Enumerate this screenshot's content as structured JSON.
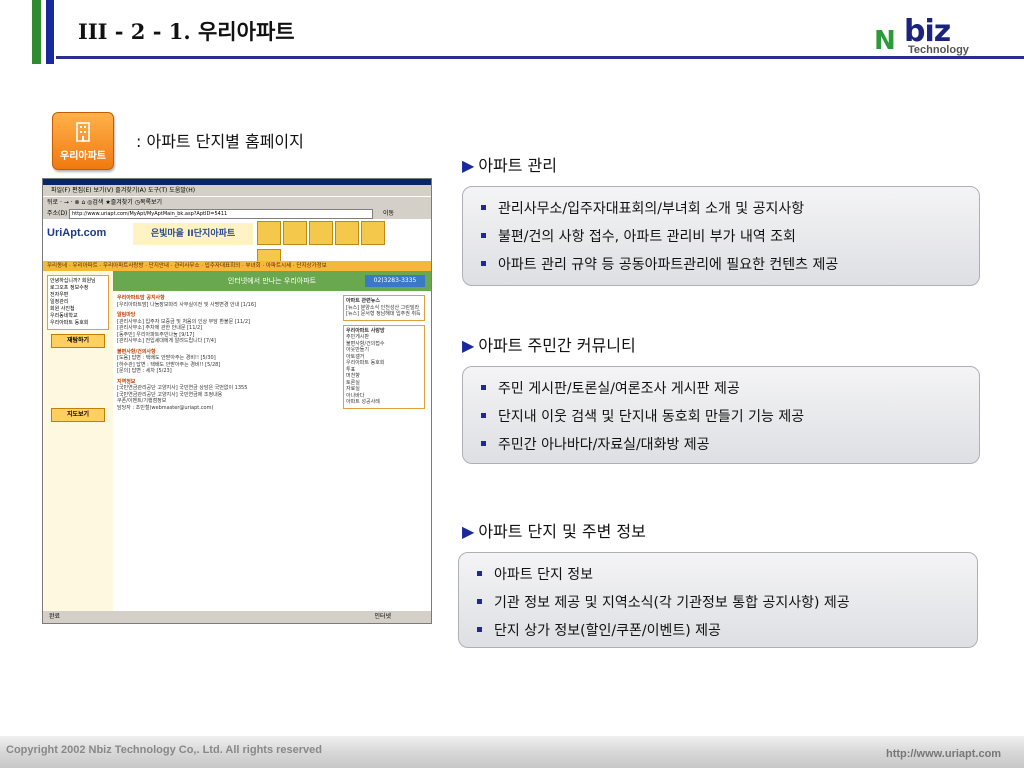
{
  "header": {
    "title": "III - 2 - 1. 우리아파트",
    "logo": {
      "n": "N",
      "biz": "biz",
      "technology": "Technology"
    }
  },
  "app_icon": {
    "label": "우리아파트",
    "name": "apartment-building-icon"
  },
  "subtitle": ": 아파트 단지별 홈페이지",
  "screenshot": {
    "menu": "파일(F)  편집(E)  보기(V)  즐겨찾기(A)  도구(T)  도움말(H)",
    "toolbar": "뒤로 ·  →  ·  ⊗  ⌂  ◎검색  ★즐겨찾기  ◷목록보기",
    "address_label": "주소(D)",
    "url": "http://www.uriapt.com/MyApt/MyAptMain_bk.asp?AptID=5411",
    "go": "이동",
    "site_logo": "UriApt.com",
    "banner": "은빛마을 II단지아파트",
    "nav": "우리동네  ·  우리아파트  ·  우리아파트사랑방  ·  단지안내  ·  관리사무소  ·  입주자대표회의  ·  부녀회  ·  아파트시세  ·  단지상가정보",
    "green_band": "인터넷에서 만나는 우리아파트",
    "phone": "02)3283-3335",
    "left_items": [
      "안녕하십니까? 회원님",
      "로그오프  정보수정",
      "전자우편",
      "일정관리",
      "회원 사진첩",
      "우리동네학교",
      "우리아파트 동호회"
    ],
    "left_buttons": [
      "재탐하기",
      "지도보기"
    ],
    "main_sections": [
      {
        "head": "우리아파트맘 공지사항",
        "lines": [
          "[우리아파트맘] 나눔장보따리 사무실이전 및 사명변경 안내 [1/16]"
        ]
      },
      {
        "head": "알림마당",
        "lines": [
          "[관리사무소] 입주자 보증금 및 처음의 인상 부담 환불문 [11/2]",
          "[관리사무소] 주차에 관한 안내문 [11/2]",
          "[동주민] 우리아파트주민나눔 [9/17]",
          "[관리사무소] 전입세대에게 알려드립니다 [7/4]"
        ]
      },
      {
        "head": "불편사항/건의사항",
        "lines": [
          "[도움] 답변 : 택배도 안받아주는 경비!! [5/30]",
          "[하수관] 답변 : 택배도 안받아주는 경비!! [5/28]",
          "[문의] 답변 : 세차 [5/23]"
        ]
      },
      {
        "head": "지역정보",
        "lines": [
          "[국민연금관리공단 고양지사] 국민연금 상담은 국번없이 1355",
          "[국민연금관리공단 고양지사] 국민연금제 조정내용",
          "쿠폰/이벤트/기행점정보",
          "담당자 : 조민철(webmaster@uriapt.com)"
        ]
      }
    ],
    "right_boxes": [
      {
        "head": "아파트 관련뉴스",
        "lines": [
          "[뉴스] 분양소식 인천성산 그린빌라",
          "[뉴스] 문서형 정남해데 입주권 취득"
        ]
      },
      {
        "head": "우리아파트 사랑방",
        "lines": [
          "주민게시판",
          "불편사항/건의접수",
          "아웃만들기",
          "아토갤거",
          "우리아파트 동호회",
          "투표",
          "머천향",
          "토론실",
          "자료실",
          "아나바다",
          "아파트 성공사례"
        ]
      }
    ],
    "status_done": "완료",
    "status_zone": "인터넷"
  },
  "sections": [
    {
      "title": "아파트 관리",
      "items": [
        "관리사무소/입주자대표회의/부녀회 소개 및 공지사항",
        "불편/건의 사항 접수, 아파트 관리비 부가 내역 조회",
        "아파트 관리 규약 등  공동아파트관리에 필요한 컨텐츠 제공"
      ]
    },
    {
      "title": "아파트 주민간 커뮤니티",
      "items": [
        "주민 게시판/토론실/여론조사 게시판 제공",
        "단지내 이웃 검색 및 단지내 동호회 만들기 기능 제공",
        "주민간 아나바다/자료실/대화방 제공"
      ]
    },
    {
      "title": "아파트 단지 및 주변 정보",
      "items": [
        "아파트 단지 정보",
        "기관 정보 제공 및 지역소식(각 기관정보 통합 공지사항) 제공",
        "단지 상가 정보(할인/쿠폰/이벤트) 제공"
      ]
    }
  ],
  "footer": {
    "copyright": "Copyright 2002 Nbiz Technology Co,. Ltd. All rights reserved",
    "url": "http://www.uriapt.com"
  },
  "colors": {
    "accent_blue": "#1a2a9a",
    "accent_green": "#2e8b2e",
    "icon_orange": "#f07a10"
  }
}
